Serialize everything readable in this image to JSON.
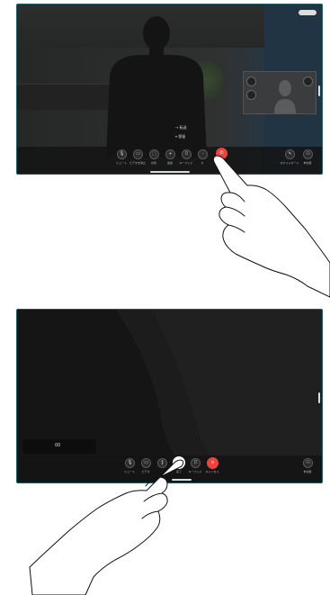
{
  "screen1": {
    "hold_menu": [
      "→ 転送",
      "⏸ 保留"
    ],
    "toolbar": [
      {
        "id": "mute",
        "label": "ミュート",
        "icon": "microphone-icon"
      },
      {
        "id": "video",
        "label": "ビデオを停止",
        "icon": "camera-icon"
      },
      {
        "id": "share",
        "label": "共有",
        "icon": "share-icon"
      },
      {
        "id": "add",
        "label": "追加",
        "icon": "plus-icon"
      },
      {
        "id": "keypad",
        "label": "キーパッド",
        "icon": "keypad-icon"
      },
      {
        "id": "more",
        "label": "カ",
        "icon": "more-icon"
      },
      {
        "id": "end",
        "label": "",
        "icon": "end-call-icon"
      }
    ],
    "right_buttons": [
      {
        "id": "whiteboard",
        "label": "ホワイトボード",
        "icon": "pen-icon"
      },
      {
        "id": "participants",
        "label": "参加者",
        "icon": "people-icon"
      }
    ]
  },
  "screen2": {
    "caption": "00",
    "toolbar": [
      {
        "id": "mute",
        "label": "ミュート",
        "icon": "microphone-icon"
      },
      {
        "id": "video",
        "label": "ビデオ",
        "icon": "camera-icon"
      },
      {
        "id": "hold",
        "label": "",
        "icon": "pause-icon"
      },
      {
        "id": "complete",
        "label": "完了",
        "icon": "check-icon"
      },
      {
        "id": "keypad",
        "label": "キーパッド",
        "icon": "keypad-icon"
      },
      {
        "id": "cancel",
        "label": "キャンセル",
        "icon": "close-icon"
      }
    ],
    "right_buttons": [
      {
        "id": "participants",
        "label": "参加者",
        "icon": "people-icon"
      }
    ]
  },
  "colors": {
    "accent_red": "#e8453c",
    "frame": "#1f5f66"
  }
}
